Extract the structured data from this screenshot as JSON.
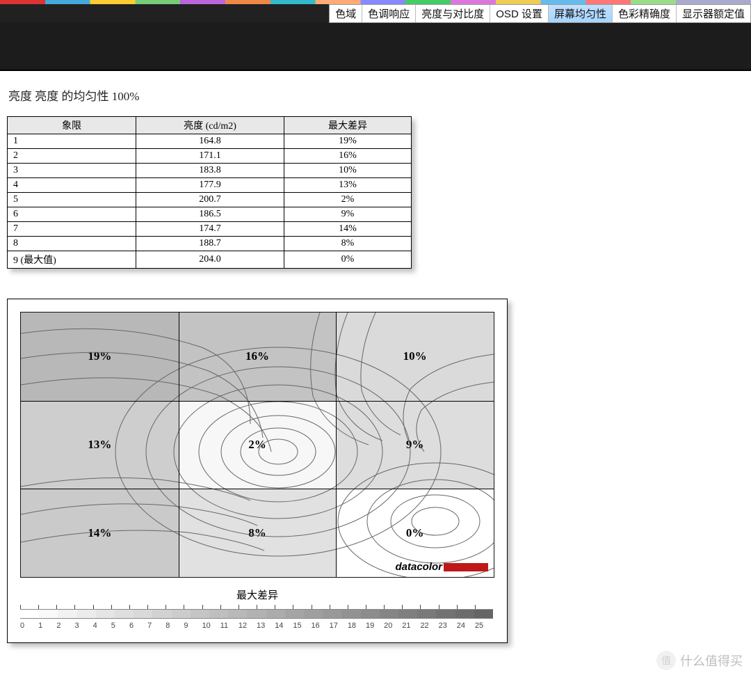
{
  "tabs": [
    {
      "label": "色域",
      "active": false
    },
    {
      "label": "色调响应",
      "active": false
    },
    {
      "label": "亮度与对比度",
      "active": false
    },
    {
      "label": "OSD 设置",
      "active": false
    },
    {
      "label": "屏幕均匀性",
      "active": true
    },
    {
      "label": "色彩精确度",
      "active": false
    },
    {
      "label": "显示器额定值",
      "active": false
    }
  ],
  "section_title": "亮度 亮度 的均匀性 100%",
  "table": {
    "headers": {
      "quadrant": "象限",
      "luminance": "亮度 (cd/m2)",
      "max_diff": "最大差异"
    },
    "rows": [
      {
        "quadrant": "1",
        "luminance": "164.8",
        "diff": "19%"
      },
      {
        "quadrant": "2",
        "luminance": "171.1",
        "diff": "16%"
      },
      {
        "quadrant": "3",
        "luminance": "183.8",
        "diff": "10%"
      },
      {
        "quadrant": "4",
        "luminance": "177.9",
        "diff": "13%"
      },
      {
        "quadrant": "5",
        "luminance": "200.7",
        "diff": "2%"
      },
      {
        "quadrant": "6",
        "luminance": "186.5",
        "diff": "9%"
      },
      {
        "quadrant": "7",
        "luminance": "174.7",
        "diff": "14%"
      },
      {
        "quadrant": "8",
        "luminance": "188.7",
        "diff": "8%"
      },
      {
        "quadrant": "9 (最大值)",
        "luminance": "204.0",
        "diff": "0%"
      }
    ]
  },
  "chart_data": {
    "type": "heatmap",
    "title": "最大差异",
    "grid": [
      [
        19,
        16,
        10
      ],
      [
        13,
        2,
        9
      ],
      [
        14,
        8,
        0
      ]
    ],
    "cell_labels": [
      [
        "19%",
        "16%",
        "10%"
      ],
      [
        "13%",
        "2%",
        "9%"
      ],
      [
        "14%",
        "8%",
        "0%"
      ]
    ],
    "legend": {
      "label": "最大差异",
      "min": 0,
      "max": 25,
      "ticks": [
        0,
        1,
        2,
        3,
        4,
        5,
        6,
        7,
        8,
        9,
        10,
        11,
        12,
        13,
        14,
        15,
        16,
        17,
        18,
        19,
        20,
        21,
        22,
        23,
        24,
        25
      ]
    },
    "brand": "datacolor"
  },
  "watermark": {
    "badge": "值",
    "text": "什么值得买"
  }
}
